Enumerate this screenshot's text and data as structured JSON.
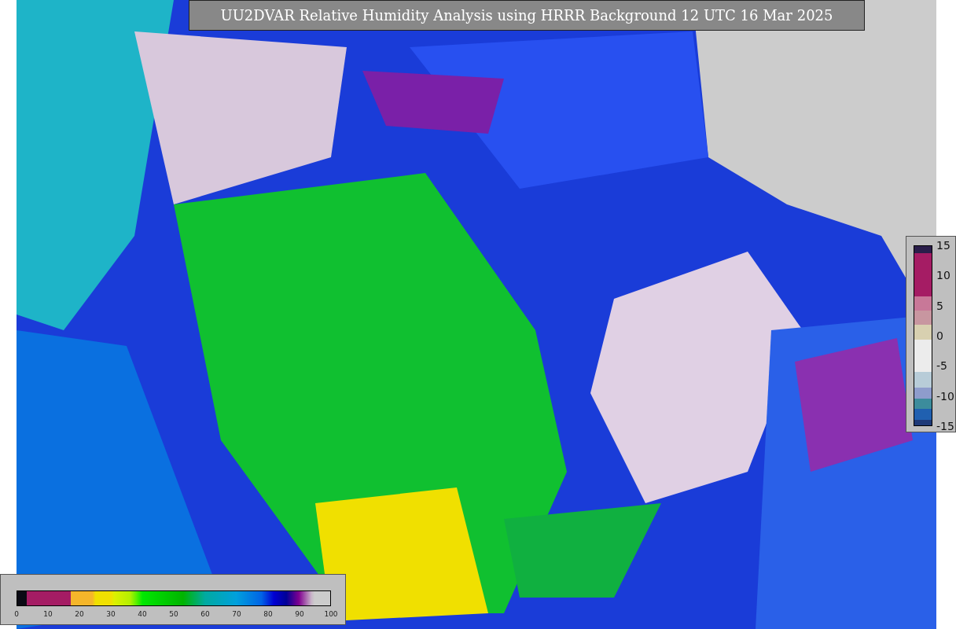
{
  "title": "UU2DVAR Relative Humidity Analysis using HRRR Background 12 UTC 16 Mar 2025",
  "humidity_colorbar": {
    "tick_labels": [
      "0",
      "10",
      "20",
      "30",
      "40",
      "50",
      "60",
      "70",
      "80",
      "90",
      "100"
    ]
  },
  "difference_colorbar": {
    "tick_labels": [
      "15",
      "10",
      "5",
      "0",
      "-5",
      "-10",
      "-15"
    ]
  }
}
